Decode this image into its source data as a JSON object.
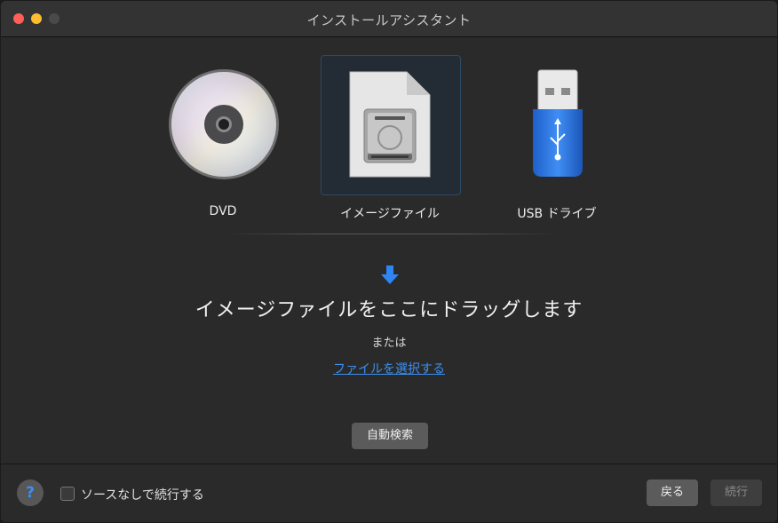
{
  "window": {
    "title": "インストールアシスタント"
  },
  "sources": {
    "dvd_label": "DVD",
    "image_label": "イメージファイル",
    "usb_label": "USB ドライブ",
    "selected": "image"
  },
  "drop_area": {
    "title": "イメージファイルをここにドラッグします",
    "or_text": "または",
    "choose_link": "ファイルを選択する"
  },
  "auto_search_label": "自動検索",
  "footer": {
    "help_label": "?",
    "checkbox_label": "ソースなしで続行する",
    "checkbox_checked": false,
    "back_label": "戻る",
    "continue_label": "続行",
    "continue_enabled": false
  },
  "colors": {
    "accent": "#3b8ff0",
    "window_bg": "#2a2a2a",
    "selection_bg": "#232c34"
  }
}
